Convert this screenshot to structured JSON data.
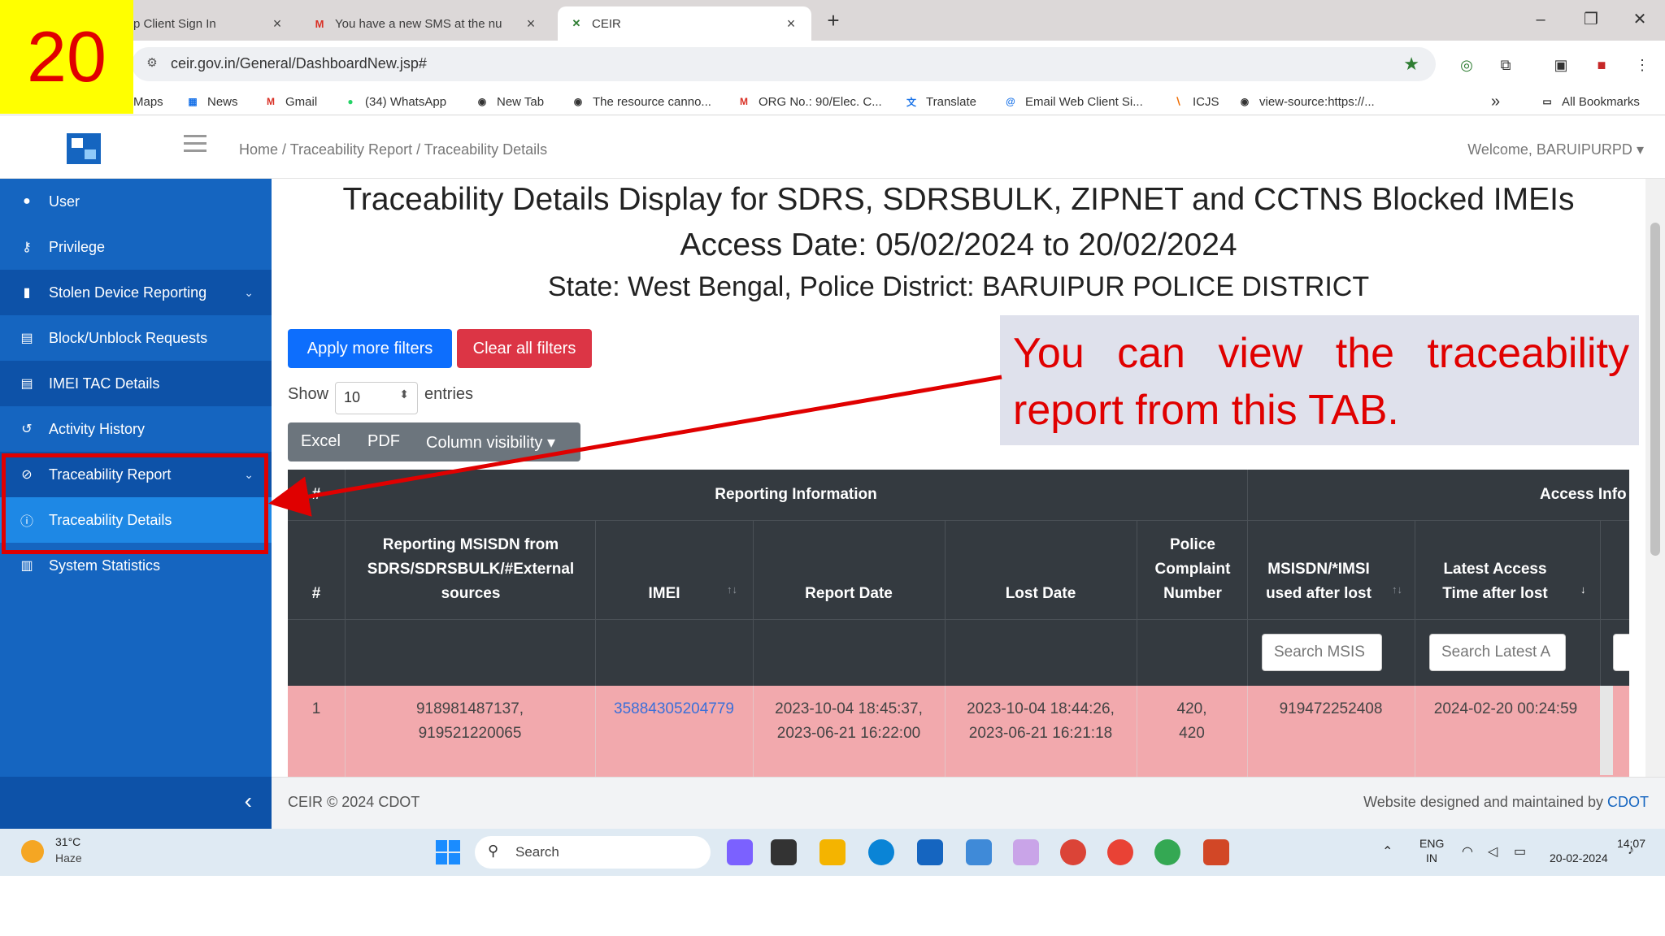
{
  "step_badge": "20",
  "browser": {
    "tabs": [
      {
        "label": "p Client Sign In",
        "icon": "page-icon",
        "active": false
      },
      {
        "label": "You have a new SMS at the nu",
        "icon": "gmail-icon",
        "active": false
      },
      {
        "label": "CEIR",
        "icon": "ceir-icon",
        "active": true
      }
    ],
    "url": "ceir.gov.in/General/DashboardNew.jsp#",
    "bookmarks": [
      "Maps",
      "News",
      "Gmail",
      "(34) WhatsApp",
      "New Tab",
      "The resource canno...",
      "ORG No.: 90/Elec. C...",
      "Translate",
      "Email Web Client Si...",
      "ICJS",
      "view-source:https://..."
    ],
    "bookmarks_more": "»",
    "all_bookmarks": "All Bookmarks"
  },
  "header": {
    "breadcrumb": "Home / Traceability Report / Traceability Details",
    "welcome": "Welcome, BARUIPURPD"
  },
  "sidebar": {
    "items": [
      {
        "label": "User",
        "icon": "user-icon"
      },
      {
        "label": "Privilege",
        "icon": "key-icon"
      },
      {
        "label": "Stolen Device Reporting",
        "icon": "phone-icon"
      },
      {
        "label": "Block/Unblock Requests",
        "icon": "list-icon"
      },
      {
        "label": "IMEI TAC Details",
        "icon": "document-icon"
      },
      {
        "label": "Activity History",
        "icon": "history-icon"
      },
      {
        "label": "Traceability Report",
        "icon": "block-icon"
      },
      {
        "label": "Traceability Details",
        "icon": "info-icon"
      },
      {
        "label": "System Statistics",
        "icon": "chart-icon"
      }
    ]
  },
  "main": {
    "title_line1": "Traceability Details Display for SDRS, SDRSBULK, ZIPNET and CCTNS Blocked IMEIs",
    "title_line2": "Access Date: 05/02/2024 to 20/02/2024",
    "title_line3": "State: West Bengal, Police District: BARUIPUR POLICE DISTRICT",
    "apply_filters": "Apply more filters",
    "clear_filters": "Clear all filters",
    "show_label": "Show",
    "entries_value": "10",
    "entries_label": "entries",
    "export": {
      "excel": "Excel",
      "pdf": "PDF",
      "column_visibility": "Column visibility"
    },
    "callout": "You can view the traceability report from this TAB.",
    "table": {
      "group_hash": "#",
      "group_reporting": "Reporting Information",
      "group_access": "Access Info",
      "columns": {
        "hash": "#",
        "msisdn": "Reporting MSISDN from SDRS/SDRSBULK/#External sources",
        "imei": "IMEI",
        "report_date": "Report Date",
        "lost_date": "Lost Date",
        "complaint": "Police Complaint Number",
        "used_after": "MSISDN/*IMSI used after lost",
        "latest_access": "Latest Access Time after lost"
      },
      "search_placeholders": {
        "used_after": "Search MSIS",
        "latest_access": "Search Latest A"
      },
      "rows": [
        {
          "no": "1",
          "msisdn_1": "918981487137,",
          "msisdn_2": "919521220065",
          "imei": "358843052047​79",
          "report_1": "2023-10-04 18:45:37,",
          "report_2": "2023-06-21 16:22:00",
          "lost_1": "2023-10-04 18:44:26,",
          "lost_2": "2023-06-21 16:21:18",
          "complaint_1": "420,",
          "complaint_2": "420",
          "used_after": "919472252408",
          "latest_access": "2024-02-20 00:24:59"
        }
      ]
    }
  },
  "footer": {
    "left": "CEIR © 2024 CDOT",
    "right_prefix": "Website designed and maintained by ",
    "right_link": "CDOT"
  },
  "taskbar": {
    "temp": "31°C",
    "weather": "Haze",
    "search": "Search",
    "lang1": "ENG",
    "lang2": "IN",
    "time": "14:07",
    "date": "20-02-2024"
  },
  "colors": {
    "sidebar": "#1565c0",
    "callout_text": "#e00000",
    "apply": "#0d6efd",
    "clear": "#dc3545",
    "row_highlight": "#f2a9ad"
  }
}
